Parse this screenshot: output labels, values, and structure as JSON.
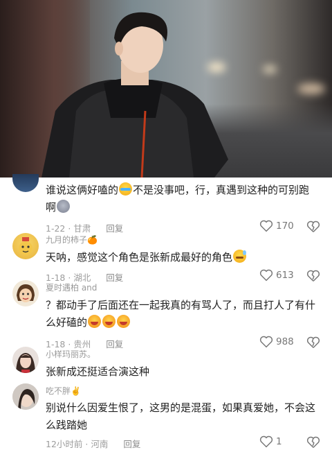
{
  "video": {
    "description_icon": "video-frame"
  },
  "comments": [
    {
      "username": "",
      "text": "谁说这俩好嗑的",
      "text_tail": "不是没事吧，行，真遇到这种的可别跑啊",
      "meta_time": "1-22 · 甘肃",
      "reply_label": "回复",
      "likes": "170"
    },
    {
      "username": "九月的柿子",
      "username_emoji": "🍊",
      "text": "天呐，感觉这个角色是张新成最好的角色",
      "meta_time": "1-18 · 湖北",
      "reply_label": "回复",
      "likes": "613"
    },
    {
      "username": "夏时遇柏 and",
      "text": "？都动手了后面还在一起我真的有骂人了，而且打人了有什么好磕的",
      "meta_time": "1-18 · 贵州",
      "reply_label": "回复",
      "likes": "988"
    },
    {
      "username": "小样玛丽苏。",
      "text": "张新成还挺适合演这种",
      "meta_time": "",
      "reply_label": "",
      "likes": ""
    },
    {
      "username": "吃不胖",
      "username_emoji": "✌️",
      "text": "别说什么因爱生恨了，这男的是混蛋，如果真爱她，不会这么践踏她",
      "meta_time": "12小时前 · 河南",
      "reply_label": "回复",
      "likes": "1"
    }
  ],
  "colors": {
    "meta": "#9c9c9c",
    "text": "#222222",
    "background": "#ffffff"
  }
}
